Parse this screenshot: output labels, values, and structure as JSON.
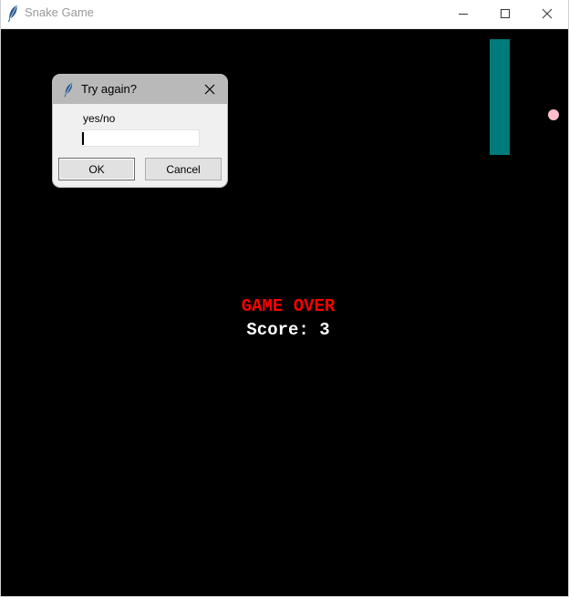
{
  "window": {
    "title": "Snake Game",
    "app_icon": "feather-icon",
    "controls": [
      "minimize-icon",
      "maximize-icon",
      "close-icon"
    ]
  },
  "game": {
    "background_color": "#000000",
    "snake_color": "#007b7b",
    "food_color": "#ffc0cb",
    "game_over_text": "GAME OVER",
    "game_over_color": "#ff0000",
    "score_text": "Score: 3"
  },
  "dialog": {
    "title": "Try again?",
    "prompt": "yes/no",
    "input_value": "",
    "ok_label": "OK",
    "cancel_label": "Cancel"
  }
}
